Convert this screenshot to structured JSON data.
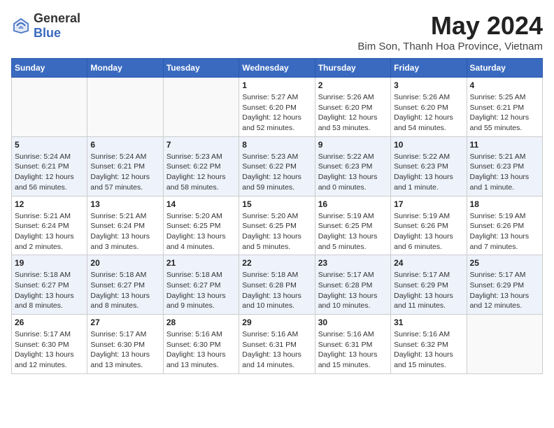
{
  "header": {
    "logo_general": "General",
    "logo_blue": "Blue",
    "month_year": "May 2024",
    "location": "Bim Son, Thanh Hoa Province, Vietnam"
  },
  "days_of_week": [
    "Sunday",
    "Monday",
    "Tuesday",
    "Wednesday",
    "Thursday",
    "Friday",
    "Saturday"
  ],
  "weeks": [
    [
      {
        "day": "",
        "info": ""
      },
      {
        "day": "",
        "info": ""
      },
      {
        "day": "",
        "info": ""
      },
      {
        "day": "1",
        "info": "Sunrise: 5:27 AM\nSunset: 6:20 PM\nDaylight: 12 hours\nand 52 minutes."
      },
      {
        "day": "2",
        "info": "Sunrise: 5:26 AM\nSunset: 6:20 PM\nDaylight: 12 hours\nand 53 minutes."
      },
      {
        "day": "3",
        "info": "Sunrise: 5:26 AM\nSunset: 6:20 PM\nDaylight: 12 hours\nand 54 minutes."
      },
      {
        "day": "4",
        "info": "Sunrise: 5:25 AM\nSunset: 6:21 PM\nDaylight: 12 hours\nand 55 minutes."
      }
    ],
    [
      {
        "day": "5",
        "info": "Sunrise: 5:24 AM\nSunset: 6:21 PM\nDaylight: 12 hours\nand 56 minutes."
      },
      {
        "day": "6",
        "info": "Sunrise: 5:24 AM\nSunset: 6:21 PM\nDaylight: 12 hours\nand 57 minutes."
      },
      {
        "day": "7",
        "info": "Sunrise: 5:23 AM\nSunset: 6:22 PM\nDaylight: 12 hours\nand 58 minutes."
      },
      {
        "day": "8",
        "info": "Sunrise: 5:23 AM\nSunset: 6:22 PM\nDaylight: 12 hours\nand 59 minutes."
      },
      {
        "day": "9",
        "info": "Sunrise: 5:22 AM\nSunset: 6:23 PM\nDaylight: 13 hours\nand 0 minutes."
      },
      {
        "day": "10",
        "info": "Sunrise: 5:22 AM\nSunset: 6:23 PM\nDaylight: 13 hours\nand 1 minute."
      },
      {
        "day": "11",
        "info": "Sunrise: 5:21 AM\nSunset: 6:23 PM\nDaylight: 13 hours\nand 1 minute."
      }
    ],
    [
      {
        "day": "12",
        "info": "Sunrise: 5:21 AM\nSunset: 6:24 PM\nDaylight: 13 hours\nand 2 minutes."
      },
      {
        "day": "13",
        "info": "Sunrise: 5:21 AM\nSunset: 6:24 PM\nDaylight: 13 hours\nand 3 minutes."
      },
      {
        "day": "14",
        "info": "Sunrise: 5:20 AM\nSunset: 6:25 PM\nDaylight: 13 hours\nand 4 minutes."
      },
      {
        "day": "15",
        "info": "Sunrise: 5:20 AM\nSunset: 6:25 PM\nDaylight: 13 hours\nand 5 minutes."
      },
      {
        "day": "16",
        "info": "Sunrise: 5:19 AM\nSunset: 6:25 PM\nDaylight: 13 hours\nand 5 minutes."
      },
      {
        "day": "17",
        "info": "Sunrise: 5:19 AM\nSunset: 6:26 PM\nDaylight: 13 hours\nand 6 minutes."
      },
      {
        "day": "18",
        "info": "Sunrise: 5:19 AM\nSunset: 6:26 PM\nDaylight: 13 hours\nand 7 minutes."
      }
    ],
    [
      {
        "day": "19",
        "info": "Sunrise: 5:18 AM\nSunset: 6:27 PM\nDaylight: 13 hours\nand 8 minutes."
      },
      {
        "day": "20",
        "info": "Sunrise: 5:18 AM\nSunset: 6:27 PM\nDaylight: 13 hours\nand 8 minutes."
      },
      {
        "day": "21",
        "info": "Sunrise: 5:18 AM\nSunset: 6:27 PM\nDaylight: 13 hours\nand 9 minutes."
      },
      {
        "day": "22",
        "info": "Sunrise: 5:18 AM\nSunset: 6:28 PM\nDaylight: 13 hours\nand 10 minutes."
      },
      {
        "day": "23",
        "info": "Sunrise: 5:17 AM\nSunset: 6:28 PM\nDaylight: 13 hours\nand 10 minutes."
      },
      {
        "day": "24",
        "info": "Sunrise: 5:17 AM\nSunset: 6:29 PM\nDaylight: 13 hours\nand 11 minutes."
      },
      {
        "day": "25",
        "info": "Sunrise: 5:17 AM\nSunset: 6:29 PM\nDaylight: 13 hours\nand 12 minutes."
      }
    ],
    [
      {
        "day": "26",
        "info": "Sunrise: 5:17 AM\nSunset: 6:30 PM\nDaylight: 13 hours\nand 12 minutes."
      },
      {
        "day": "27",
        "info": "Sunrise: 5:17 AM\nSunset: 6:30 PM\nDaylight: 13 hours\nand 13 minutes."
      },
      {
        "day": "28",
        "info": "Sunrise: 5:16 AM\nSunset: 6:30 PM\nDaylight: 13 hours\nand 13 minutes."
      },
      {
        "day": "29",
        "info": "Sunrise: 5:16 AM\nSunset: 6:31 PM\nDaylight: 13 hours\nand 14 minutes."
      },
      {
        "day": "30",
        "info": "Sunrise: 5:16 AM\nSunset: 6:31 PM\nDaylight: 13 hours\nand 15 minutes."
      },
      {
        "day": "31",
        "info": "Sunrise: 5:16 AM\nSunset: 6:32 PM\nDaylight: 13 hours\nand 15 minutes."
      },
      {
        "day": "",
        "info": ""
      }
    ]
  ]
}
